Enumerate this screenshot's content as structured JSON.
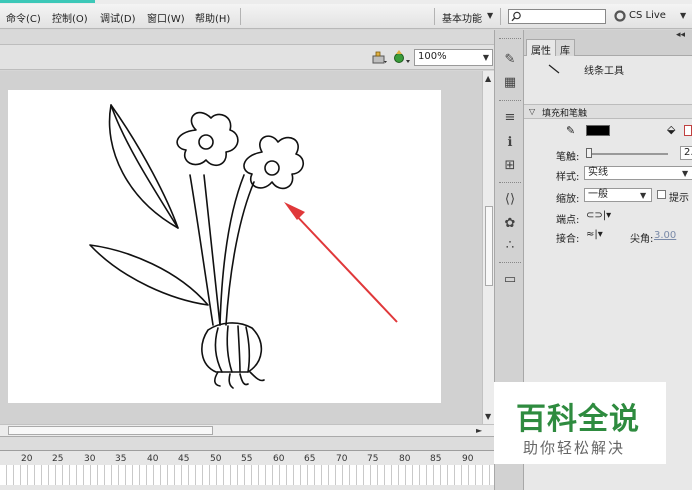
{
  "menu": {
    "items": [
      "命令(C)",
      "控制(O)",
      "调试(D)",
      "窗口(W)",
      "帮助(H)"
    ],
    "workspace_label": "基本功能",
    "search_placeholder": "",
    "cslive_label": "CS Live"
  },
  "stage": {
    "zoom": "100%"
  },
  "timeline": {
    "ruler_labels": [
      "20",
      "25",
      "30",
      "35",
      "40",
      "45",
      "50",
      "55",
      "60",
      "65",
      "70",
      "75",
      "80",
      "85",
      "90"
    ]
  },
  "panel": {
    "tabs": [
      "属性",
      "库"
    ],
    "tool_name": "线条工具",
    "section_fill_stroke": "填充和笔触",
    "stroke_label": "笔触:",
    "stroke_value": "2.",
    "style_label": "样式:",
    "style_value": "实线",
    "scale_label": "缩放:",
    "scale_value": "一般",
    "hint_label": "提示",
    "cap_label": "端点:",
    "join_label": "接合:",
    "miter_label": "尖角:",
    "miter_value": "3.00"
  },
  "watermark": {
    "title": "百科全说",
    "subtitle": "助你轻松解决"
  },
  "colors": {
    "stroke_color": "#000000",
    "arrow_color": "#e0383a",
    "watermark_green": "#2e8b3f"
  }
}
